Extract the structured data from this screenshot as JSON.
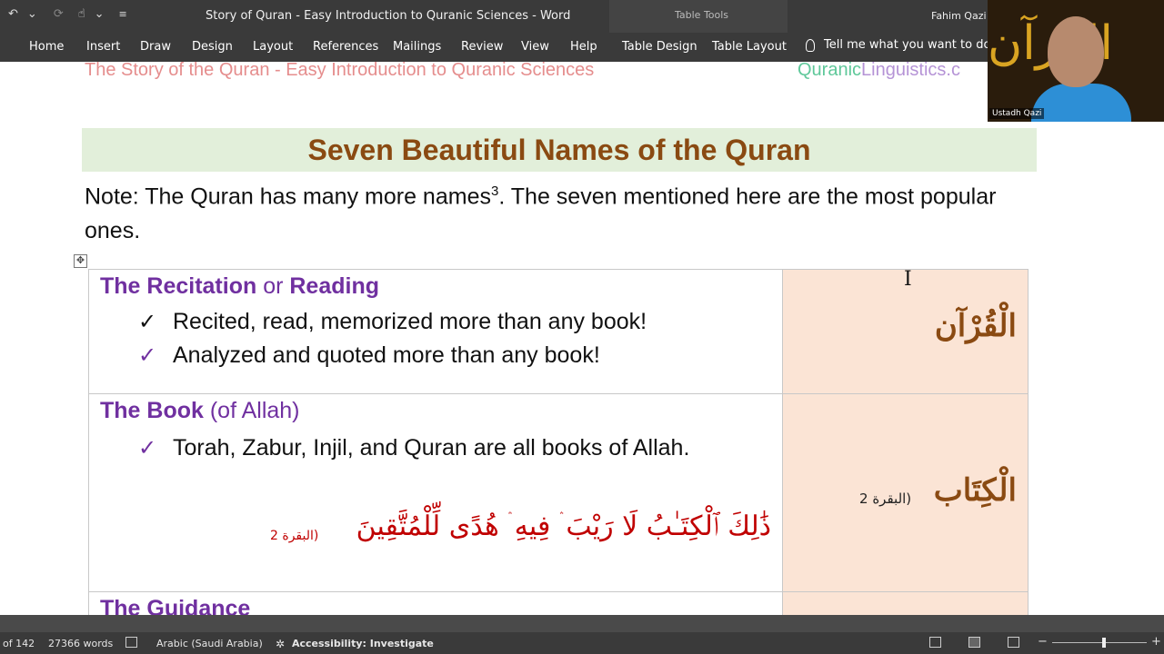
{
  "window": {
    "title": "Story of Quran - Easy Introduction to Quranic Sciences  -  Word",
    "user": "Fahim Qazi",
    "context_tab_group": "Table Tools"
  },
  "quick_access": {
    "undo": "↶",
    "undo_more": "⌄",
    "redo": "⟳",
    "touch": "☝",
    "touch_more": "⌄",
    "customize": "≡"
  },
  "ribbon": {
    "tabs": [
      "Home",
      "Insert",
      "Draw",
      "Design",
      "Layout",
      "References",
      "Mailings",
      "Review",
      "View",
      "Help",
      "Table Design",
      "Table Layout"
    ],
    "tell_me": "Tell me what you want to do"
  },
  "webcam": {
    "name": "Ustadh Qazi",
    "calligraphy": "القرآن"
  },
  "document": {
    "header_left": "The Story of the Quran - Easy Introduction to Quranic Sciences",
    "header_right_a": "Quranic",
    "header_right_b": "Linguistics.c",
    "banner_title": "Seven Beautiful Names of the Quran",
    "note_text": "Note: The Quran has many more names",
    "note_sup": "3",
    "note_text_2": ". The seven mentioned here are the most popular ones.",
    "table_move_handle": "✥",
    "rows": [
      {
        "heading_bold": "The Recitation",
        "heading_mid": " or ",
        "heading_bold_2": "Reading",
        "bullets": [
          {
            "mark": "✓",
            "text": "Recited, read, memorized more than any book!"
          },
          {
            "mark": "✓",
            "text": "Analyzed and quoted more than any book!"
          }
        ],
        "arabic_name": "الْقُرْآن"
      },
      {
        "heading_bold": "The Book",
        "heading_light": " (of Allah)",
        "bullets": [
          {
            "mark": "✓",
            "text": "Torah, Zabur, Injil, and Quran are all books of Allah."
          }
        ],
        "verse": "ذَٰلِكَ ٱلْكِتَـٰبُ لَا رَيْبَ ۛ فِيهِ ۛ هُدًى لِّلْمُتَّقِينَ",
        "verse_ref": "(البقرة 2",
        "arabic_name": "الْكِتَاب",
        "arabic_ref": "(البقرة 2"
      },
      {
        "heading_bold": "The Guidance"
      }
    ],
    "cursor": "I"
  },
  "statusbar": {
    "page": "of 142",
    "words": "27366 words",
    "language": "Arabic (Saudi Arabia)",
    "accessibility": "Accessibility: Investigate"
  }
}
